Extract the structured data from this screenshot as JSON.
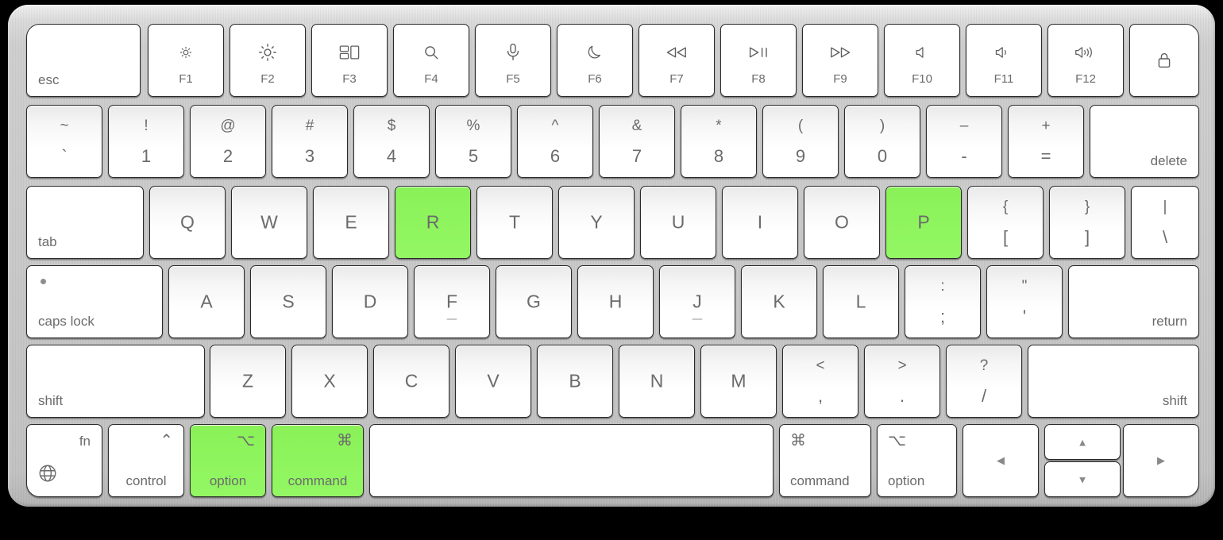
{
  "device": {
    "name": "apple-magic-keyboard-with-touch-id",
    "body_color": "#c9c9c9",
    "background_color": "#000000",
    "key_face_color": "#ffffff",
    "key_text_color": "#6b6b6b",
    "highlight_color": "#8ef45d"
  },
  "highlighted_keys": [
    "R",
    "P",
    "option",
    "command"
  ],
  "rows": {
    "function_row": [
      {
        "id": "esc",
        "label": "esc",
        "align": "bottom-left"
      },
      {
        "id": "f1",
        "icon": "brightness-down-icon",
        "label": "F1"
      },
      {
        "id": "f2",
        "icon": "brightness-up-icon",
        "label": "F2"
      },
      {
        "id": "f3",
        "icon": "mission-control-icon",
        "label": "F3"
      },
      {
        "id": "f4",
        "icon": "spotlight-search-icon",
        "label": "F4"
      },
      {
        "id": "f5",
        "icon": "dictation-mic-icon",
        "label": "F5"
      },
      {
        "id": "f6",
        "icon": "do-not-disturb-moon-icon",
        "label": "F6"
      },
      {
        "id": "f7",
        "icon": "rewind-icon",
        "label": "F7"
      },
      {
        "id": "f8",
        "icon": "play-pause-icon",
        "label": "F8"
      },
      {
        "id": "f9",
        "icon": "fast-forward-icon",
        "label": "F9"
      },
      {
        "id": "f10",
        "icon": "mute-icon",
        "label": "F10"
      },
      {
        "id": "f11",
        "icon": "volume-down-icon",
        "label": "F11"
      },
      {
        "id": "f12",
        "icon": "volume-up-icon",
        "label": "F12"
      },
      {
        "id": "touchid",
        "icon": "lock-touch-id-icon",
        "label": ""
      }
    ],
    "number_row": [
      {
        "id": "backtick",
        "top": "~",
        "bottom": "`"
      },
      {
        "id": "1",
        "top": "!",
        "bottom": "1"
      },
      {
        "id": "2",
        "top": "@",
        "bottom": "2"
      },
      {
        "id": "3",
        "top": "#",
        "bottom": "3"
      },
      {
        "id": "4",
        "top": "$",
        "bottom": "4"
      },
      {
        "id": "5",
        "top": "%",
        "bottom": "5"
      },
      {
        "id": "6",
        "top": "^",
        "bottom": "6"
      },
      {
        "id": "7",
        "top": "&",
        "bottom": "7"
      },
      {
        "id": "8",
        "top": "*",
        "bottom": "8"
      },
      {
        "id": "9",
        "top": "(",
        "bottom": "9"
      },
      {
        "id": "0",
        "top": ")",
        "bottom": "0"
      },
      {
        "id": "minus",
        "top": "–",
        "bottom": "-"
      },
      {
        "id": "equal",
        "top": "+",
        "bottom": "="
      },
      {
        "id": "delete",
        "label": "delete",
        "align": "bottom-right"
      }
    ],
    "top_row": [
      {
        "id": "tab",
        "label": "tab",
        "align": "bottom-left"
      },
      {
        "id": "Q",
        "label": "Q"
      },
      {
        "id": "W",
        "label": "W"
      },
      {
        "id": "E",
        "label": "E"
      },
      {
        "id": "R",
        "label": "R",
        "highlighted": true
      },
      {
        "id": "T",
        "label": "T"
      },
      {
        "id": "Y",
        "label": "Y"
      },
      {
        "id": "U",
        "label": "U"
      },
      {
        "id": "I",
        "label": "I"
      },
      {
        "id": "O",
        "label": "O"
      },
      {
        "id": "P",
        "label": "P",
        "highlighted": true
      },
      {
        "id": "bracketleft",
        "top": "{",
        "bottom": "["
      },
      {
        "id": "bracketright",
        "top": "}",
        "bottom": "]"
      },
      {
        "id": "backslash",
        "top": "|",
        "bottom": "\\"
      }
    ],
    "home_row": [
      {
        "id": "capslock",
        "label": "caps lock",
        "align": "bottom-left",
        "led": true
      },
      {
        "id": "A",
        "label": "A"
      },
      {
        "id": "S",
        "label": "S"
      },
      {
        "id": "D",
        "label": "D"
      },
      {
        "id": "F",
        "label": "F",
        "bump": true
      },
      {
        "id": "G",
        "label": "G"
      },
      {
        "id": "H",
        "label": "H"
      },
      {
        "id": "J",
        "label": "J",
        "bump": true
      },
      {
        "id": "K",
        "label": "K"
      },
      {
        "id": "L",
        "label": "L"
      },
      {
        "id": "semicolon",
        "top": ":",
        "bottom": ";"
      },
      {
        "id": "quote",
        "top": "\"",
        "bottom": "'"
      },
      {
        "id": "return",
        "label": "return",
        "align": "bottom-right"
      }
    ],
    "bottom_letter_row": [
      {
        "id": "lshift",
        "label": "shift",
        "align": "bottom-left"
      },
      {
        "id": "Z",
        "label": "Z"
      },
      {
        "id": "X",
        "label": "X"
      },
      {
        "id": "C",
        "label": "C"
      },
      {
        "id": "V",
        "label": "V"
      },
      {
        "id": "B",
        "label": "B"
      },
      {
        "id": "N",
        "label": "N"
      },
      {
        "id": "M",
        "label": "M"
      },
      {
        "id": "comma",
        "top": "<",
        "bottom": ","
      },
      {
        "id": "period",
        "top": ">",
        "bottom": "."
      },
      {
        "id": "slash",
        "top": "?",
        "bottom": "/"
      },
      {
        "id": "rshift",
        "label": "shift",
        "align": "bottom-right"
      }
    ],
    "modifier_row": [
      {
        "id": "fn",
        "label": "fn",
        "icon": "globe-icon"
      },
      {
        "id": "control",
        "symbol": "⌃",
        "label": "control"
      },
      {
        "id": "loption",
        "symbol": "⌥",
        "label": "option",
        "highlighted": true
      },
      {
        "id": "lcommand",
        "symbol": "⌘",
        "label": "command",
        "highlighted": true
      },
      {
        "id": "space",
        "label": ""
      },
      {
        "id": "rcommand",
        "symbol": "⌘",
        "label": "command"
      },
      {
        "id": "roption",
        "symbol": "⌥",
        "label": "option"
      },
      {
        "id": "arrowleft",
        "glyph": "◀",
        "icon": "arrow-left-icon"
      },
      {
        "id": "arrowup",
        "glyph": "▲",
        "icon": "arrow-up-icon"
      },
      {
        "id": "arrowdown",
        "glyph": "▼",
        "icon": "arrow-down-icon"
      },
      {
        "id": "arrowright",
        "glyph": "▶",
        "icon": "arrow-right-icon"
      }
    ]
  }
}
